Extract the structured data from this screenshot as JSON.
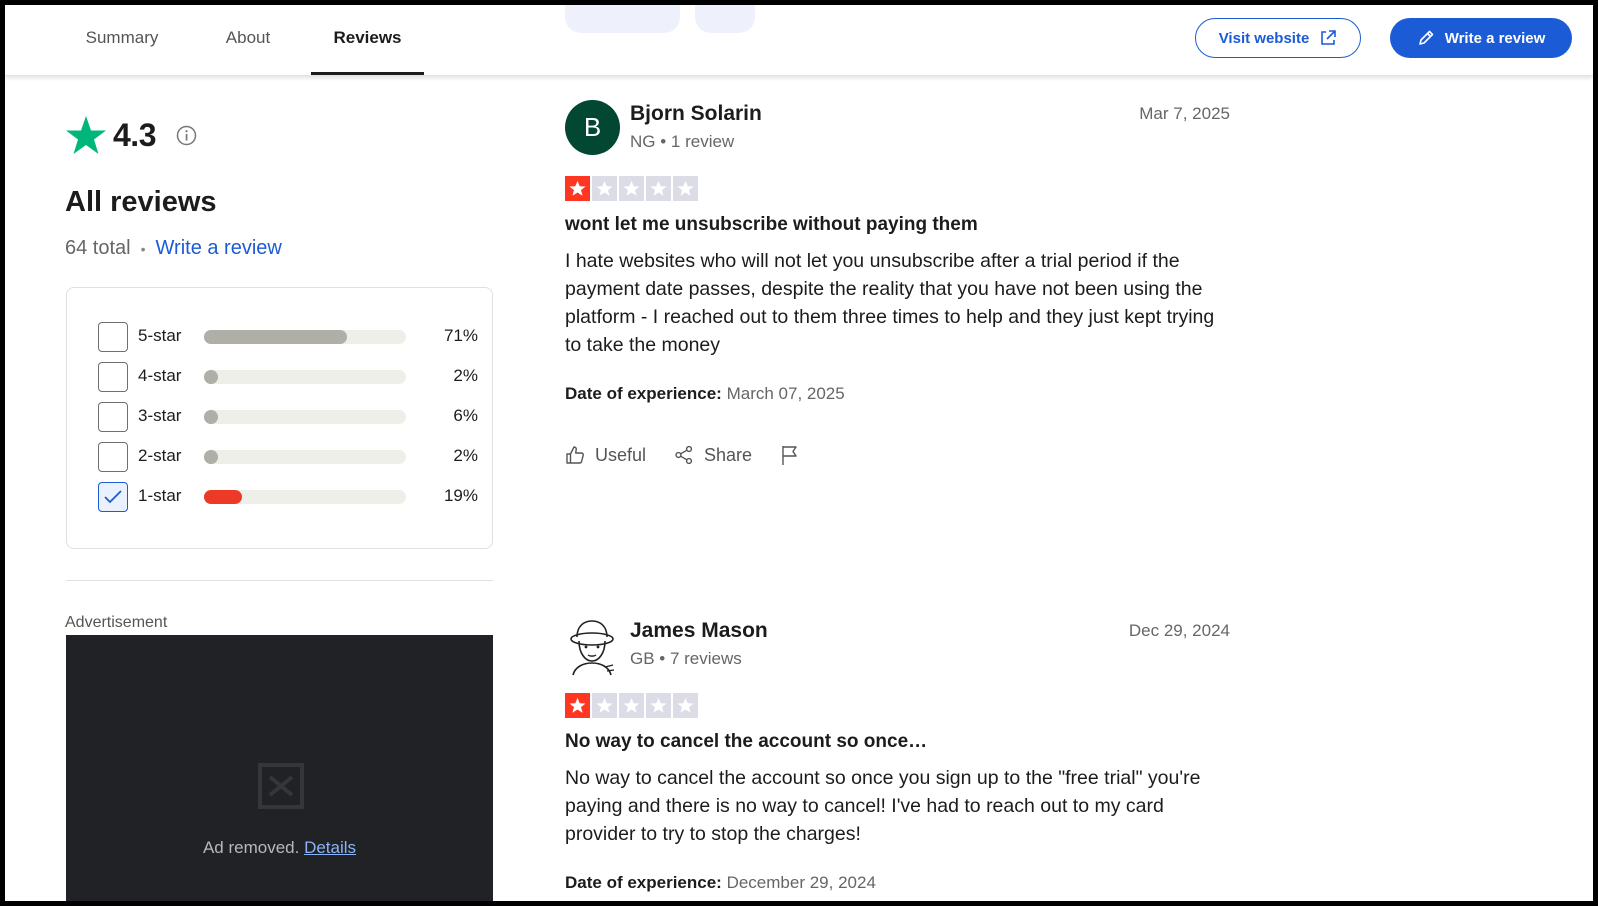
{
  "header": {
    "tabs": [
      {
        "label": "Summary"
      },
      {
        "label": "About"
      },
      {
        "label": "Reviews",
        "active": true
      }
    ],
    "visit_website_label": "Visit website",
    "write_review_label": "Write a review"
  },
  "summary": {
    "rating": "4.3",
    "heading": "All reviews",
    "total": "64 total",
    "write_review_link": "Write a review",
    "filters": [
      {
        "label": "5-star",
        "percent_label": "71%",
        "percent": 71,
        "checked": false
      },
      {
        "label": "4-star",
        "percent_label": "2%",
        "percent": 2,
        "checked": false
      },
      {
        "label": "3-star",
        "percent_label": "6%",
        "percent": 6,
        "checked": false
      },
      {
        "label": "2-star",
        "percent_label": "2%",
        "percent": 2,
        "checked": false
      },
      {
        "label": "1-star",
        "percent_label": "19%",
        "percent": 19,
        "checked": true
      }
    ]
  },
  "ad": {
    "label": "Advertisement",
    "removed_text": "Ad removed.",
    "details_link": "Details"
  },
  "reviews": [
    {
      "avatar_letter": "B",
      "name": "Bjorn Solarin",
      "meta": "NG • 1 review",
      "date": "Mar 7, 2025",
      "stars": 1,
      "title": "wont let me unsubscribe without paying them",
      "body": "I hate websites who will not let you unsubscribe after a trial period if the payment date passes, despite the reality that you have not been using the platform - I reached out to them three times to help and they just kept trying to take the money",
      "experience_label": "Date of experience:",
      "experience_date": "March 07, 2025",
      "useful_label": "Useful",
      "share_label": "Share"
    },
    {
      "name": "James Mason",
      "meta": "GB • 7 reviews",
      "date": "Dec 29, 2024",
      "stars": 1,
      "title": "No way to cancel the account so once…",
      "body": "No way to cancel the account so once you sign up to the \"free trial\" you're paying and there is no way to cancel! I've had to reach out to my card provider to try to stop the charges!",
      "experience_label": "Date of experience:",
      "experience_date": "December 29, 2024"
    }
  ],
  "colors": {
    "accent": "#1c5bd6",
    "trust_green": "#00b67a",
    "star_red": "#ff3722",
    "bar_red": "#ec3a27",
    "avatar_green": "#024732"
  }
}
